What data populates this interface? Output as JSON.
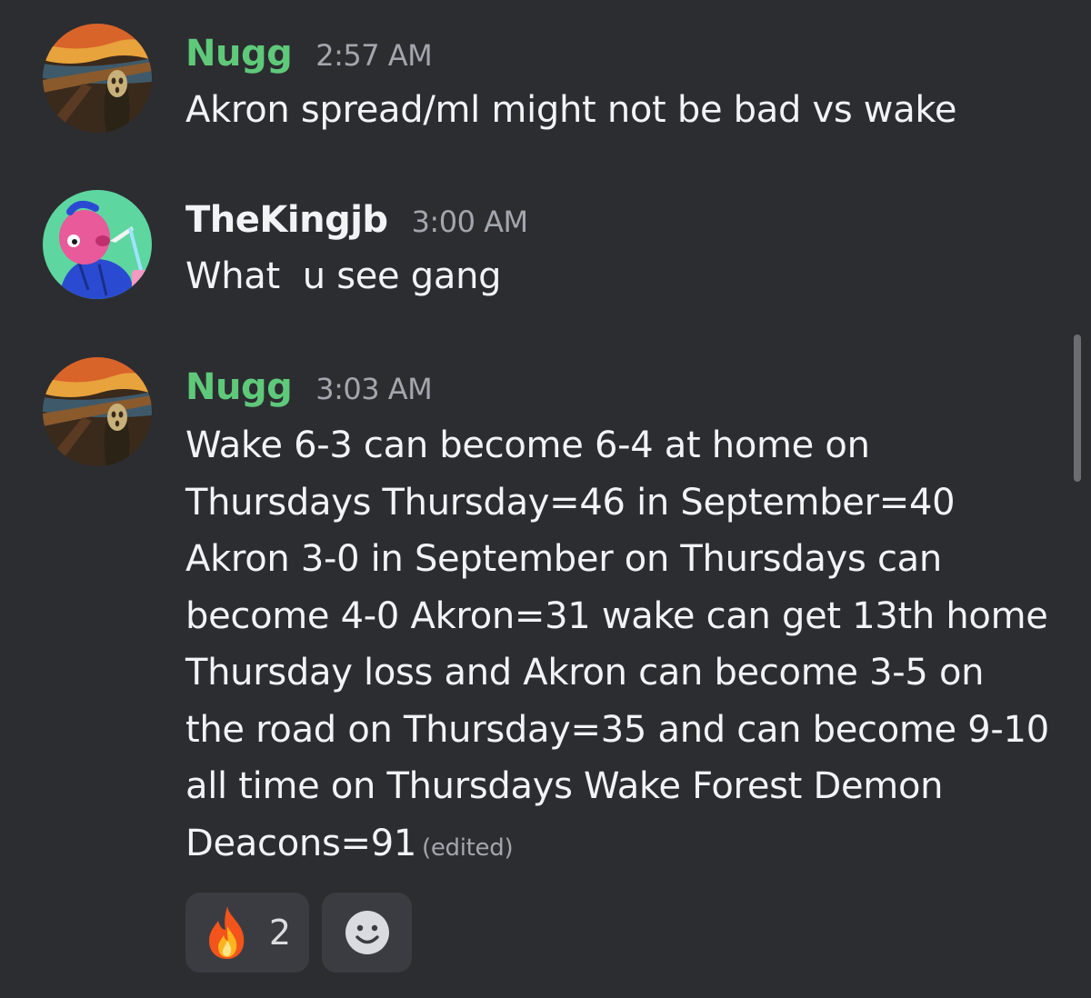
{
  "messages": [
    {
      "username": "Nugg",
      "timestamp": "2:57 AM",
      "lines": [
        "Akron spread/ml might not be bad vs wake"
      ]
    },
    {
      "username": "TheKingjb",
      "timestamp": "3:00 AM",
      "lines": [
        "What  u see gang"
      ]
    },
    {
      "username": "Nugg",
      "timestamp": "3:03 AM",
      "lines": [
        "Wake 6-3 can become 6-4 at home on",
        "Thursdays Thursday=46 in September=40",
        "Akron 3-0 in September on Thursdays can",
        "become 4-0 Akron=31 wake can get 13th home",
        "Thursday loss and Akron can become 3-5 on",
        "the road on Thursday=35 and can become 9-10",
        "all time on Thursdays Wake Forest Demon",
        "Deacons=91"
      ],
      "edited": "(edited)",
      "reactions": [
        {
          "emoji": "fire-icon",
          "count": "2"
        },
        {
          "emoji": "add-reaction-icon"
        }
      ]
    }
  ],
  "colors": {
    "background": "#2c2d31",
    "nugg_name": "#5fc97a",
    "kingjb_name": "#f2f3f5",
    "timestamp": "#a3a6ad",
    "text": "#f2f3f5",
    "reaction_bg": "#3b3c42"
  }
}
